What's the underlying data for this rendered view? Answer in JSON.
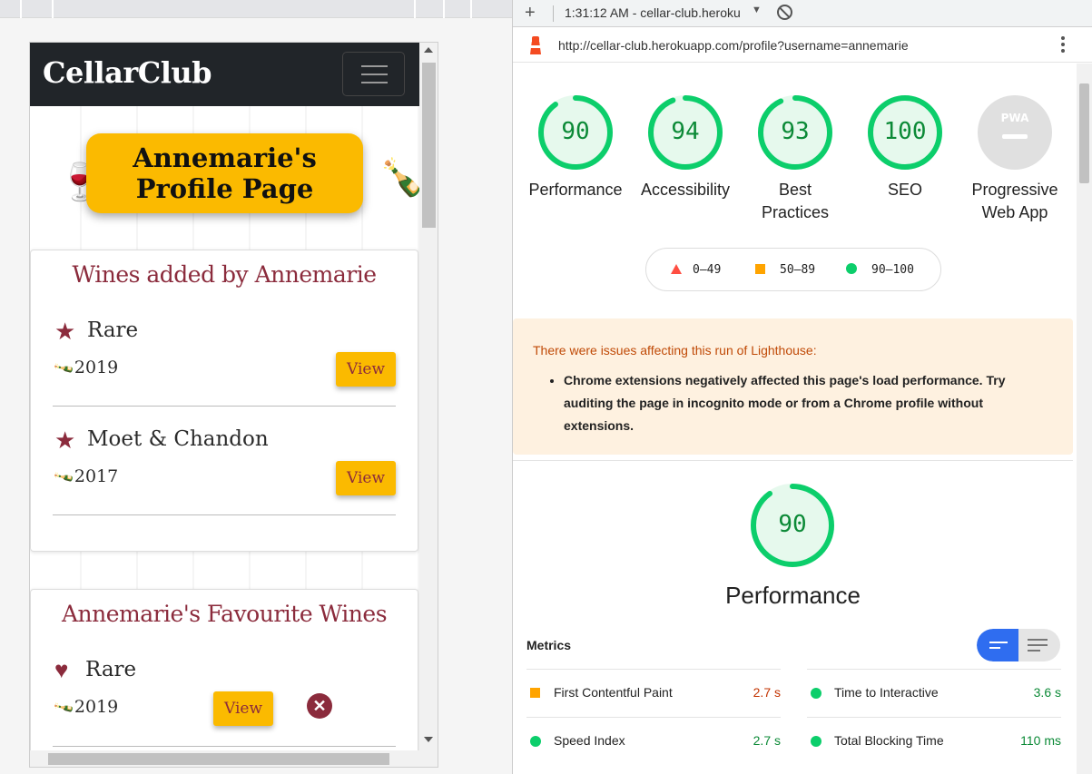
{
  "site": {
    "brand": "CellarClub",
    "hero_title_line1": "Annemarie's",
    "hero_title_line2": "Profile Page",
    "added_card": {
      "title": "Wines added by Annemarie",
      "wines": [
        {
          "name": "Rare",
          "year": "2019",
          "button": "View"
        },
        {
          "name": "Moet & Chandon",
          "year": "2017",
          "button": "View"
        }
      ]
    },
    "favourites_card": {
      "title": "Annemarie's Favourite Wines",
      "wines": [
        {
          "name": "Rare",
          "year": "2019",
          "button": "View"
        }
      ]
    },
    "colors": {
      "nav_bg": "#212529",
      "accent_yellow": "#fbba00",
      "burgundy": "#8b2b3c"
    }
  },
  "lighthouse": {
    "toolbar": {
      "run_label": "1:31:12 AM - cellar-club.heroku"
    },
    "url": "http://cellar-club.herokuapp.com/profile?username=annemarie",
    "gauges": [
      {
        "score": "90",
        "value": 90,
        "label": "Performance"
      },
      {
        "score": "94",
        "value": 94,
        "label": "Accessibility"
      },
      {
        "score": "93",
        "value": 93,
        "label": "Best Practices"
      },
      {
        "score": "100",
        "value": 100,
        "label": "SEO"
      },
      {
        "score": "PWA",
        "value": null,
        "label": "Progressive Web App"
      }
    ],
    "legend": [
      {
        "range": "0–49",
        "icon": "triangle-icon",
        "color": "#ff4e42"
      },
      {
        "range": "50–89",
        "icon": "square-icon",
        "color": "#ffa400"
      },
      {
        "range": "90–100",
        "icon": "circle-icon",
        "color": "#0cce6b"
      }
    ],
    "warning": {
      "title": "There were issues affecting this run of Lighthouse:",
      "items": [
        "Chrome extensions negatively affected this page's load performance. Try auditing the page in incognito mode or from a Chrome profile without extensions."
      ]
    },
    "performance": {
      "score": "90",
      "value": 90,
      "title": "Performance"
    },
    "metrics_label": "Metrics",
    "metrics": [
      {
        "name": "First Contentful Paint",
        "value": "2.7 s",
        "status": "average"
      },
      {
        "name": "Time to Interactive",
        "value": "3.6 s",
        "status": "pass"
      },
      {
        "name": "Speed Index",
        "value": "2.7 s",
        "status": "pass"
      },
      {
        "name": "Total Blocking Time",
        "value": "110 ms",
        "status": "pass"
      }
    ],
    "colors": {
      "pass": "#0cce6b",
      "pass_text": "#0c8a37",
      "average": "#ffa400",
      "average_text": "#c33300",
      "fail": "#ff4e42",
      "toggle_on": "#2f6df0"
    }
  }
}
